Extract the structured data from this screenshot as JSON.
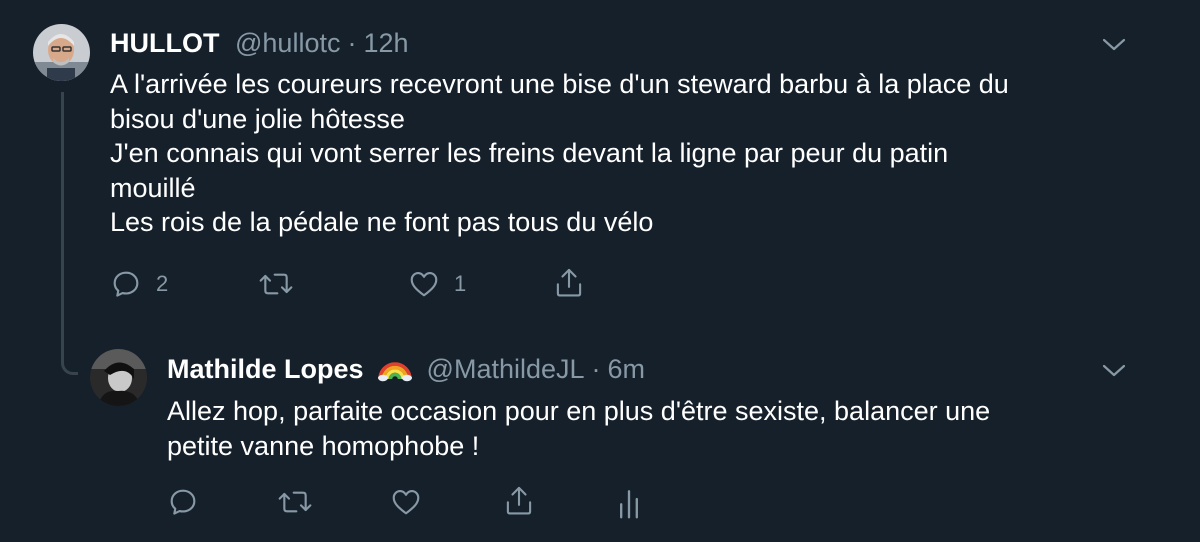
{
  "tweet": {
    "display_name": "HULLOT",
    "handle": "@hullotc",
    "separator": "·",
    "time": "12h",
    "lines": [
      "A l'arrivée les coureurs recevront une bise d'un steward barbu à la place du",
      "bisou d'une jolie hôtesse",
      "J'en connais qui vont serrer les freins devant la ligne par peur du patin",
      "mouillé",
      "Les rois de la pédale ne font pas tous du vélo"
    ],
    "reply_count": "2",
    "retweet_count": "",
    "like_count": "1"
  },
  "reply": {
    "display_name": "Mathilde Lopes",
    "handle": "@MathildeJL",
    "separator": "·",
    "time": "6m",
    "lines": [
      "Allez hop, parfaite occasion pour en plus d'être sexiste, balancer une",
      "petite vanne homophobe !"
    ]
  },
  "colors": {
    "background": "#15202b",
    "text": "#ffffff",
    "secondary": "#8899a6",
    "thread_line": "#38444d"
  },
  "icons": {
    "reply": "reply-icon",
    "retweet": "retweet-icon",
    "like": "heart-icon",
    "share": "share-icon",
    "analytics": "analytics-icon",
    "more": "chevron-down-icon",
    "badge": "rainbow-emoji"
  }
}
